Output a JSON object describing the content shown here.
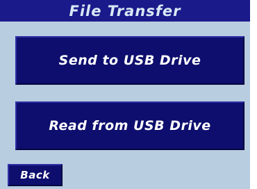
{
  "header": {
    "title": "File Transfer"
  },
  "buttons": {
    "send_label": "Send to USB Drive",
    "read_label": "Read from USB Drive",
    "back_label": "Back"
  },
  "colors": {
    "screen_background": "#b8cde0",
    "title_bar": "#1a1a8a",
    "title_text": "#d9e8f5",
    "button_background": "#0e0e6e",
    "button_text": "#ffffff"
  }
}
